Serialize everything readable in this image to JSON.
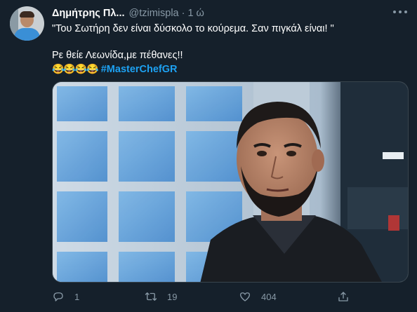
{
  "tweet": {
    "author_name": "Δημήτρης Πλ...",
    "handle": "@tzimispla",
    "separator": "·",
    "time": "1 ώ",
    "line1": "\"Του Σωτήρη δεν είναι δύσκολο το κούρεμα. Σαν πιγκάλ είναι! \"",
    "line2": "Ρε θείε Λεωνίδα,με πέθανες!!",
    "emojis": "😂😂😂😂",
    "hashtag": "#MasterChefGR"
  },
  "actions": {
    "reply_count": "1",
    "retweet_count": "19",
    "like_count": "404"
  },
  "colors": {
    "background": "#15202b",
    "text": "#ffffff",
    "secondary": "#8899a6",
    "accent": "#1da1f2"
  },
  "icons": [
    "more-icon",
    "reply-icon",
    "retweet-icon",
    "like-icon",
    "share-icon"
  ]
}
